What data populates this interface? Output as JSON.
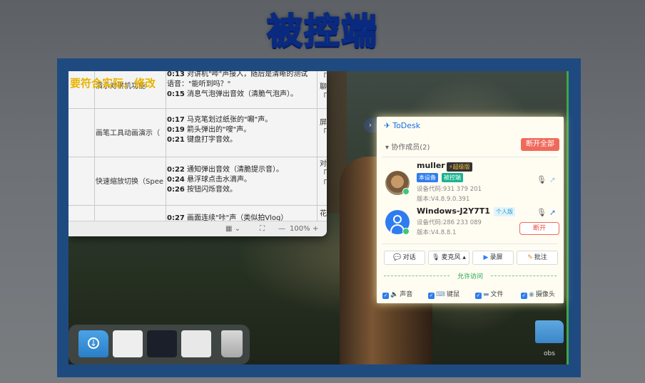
{
  "title": "被控端",
  "doc": {
    "overlay_text": "要符合实际，修改",
    "rows": [
      {
        "label": "演示对讲机功能",
        "lines": [
          {
            "t": "0:13",
            "d": " 对讲机\"哔\"声接入，随后是清晰的测试"
          },
          {
            "t": "",
            "d": "语音：\"能听到吗？\""
          },
          {
            "t": "0:15",
            "d": " 消息气泡弹出音效（清脆气泡声）。"
          }
        ],
        "right": [
          "「",
          "聊",
          "「"
        ]
      },
      {
        "label": "画笔工具动画演示（",
        "lines": [
          {
            "t": "0:17",
            "d": " 马克笔划过纸张的\"唰\"声。"
          },
          {
            "t": "0:19",
            "d": " 箭头弹出的\"嗖\"声。"
          },
          {
            "t": "0:21",
            "d": " 键盘打字音效。"
          }
        ],
        "right": [
          "屏",
          "「"
        ]
      },
      {
        "label": "快速缩放切换（Spee",
        "lines": [
          {
            "t": "0:22",
            "d": " 通知弹出音效（清脆提示音）。"
          },
          {
            "t": "0:24",
            "d": " 悬浮球点击水滴声。"
          },
          {
            "t": "0:26",
            "d": " 按钮闪烁音效。"
          }
        ],
        "right": [
          "对",
          "「",
          "「"
        ]
      },
      {
        "label": "",
        "lines": [
          {
            "t": "0:27",
            "d": " 画面连续\"咔\"声（类似拍Vlog）"
          }
        ],
        "right": [
          "花"
        ]
      }
    ],
    "status": {
      "zoom_minus": "—",
      "zoom": "100%",
      "zoom_plus": "+"
    }
  },
  "desktop": {
    "obs_label": "obs"
  },
  "todesk": {
    "brand": "ToDesk",
    "collapse_icon": "›",
    "section": "协作成员(2)",
    "disconnect_all": "断开全部",
    "members": [
      {
        "name": "muller",
        "badge": "超级版",
        "tags": [
          "本设备",
          "被控端"
        ],
        "device_code": "设备代码:931 379 201",
        "version": "版本:V4.8.9.0.391"
      },
      {
        "name": "Windows-J2Y7T1",
        "tag": "个人版",
        "device_code": "设备代码:286 233 089",
        "version": "版本:V4.8.8.1",
        "disconnect": "断开"
      }
    ],
    "tools": [
      "对话",
      "麦克风",
      "录屏",
      "批注"
    ],
    "permission_title": "允许访问",
    "permissions": [
      "声音",
      "键鼠",
      "文件",
      "摄像头"
    ]
  }
}
